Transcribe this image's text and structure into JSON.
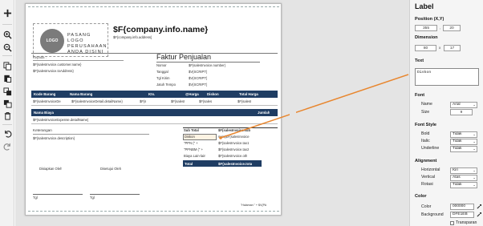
{
  "toolbar": {
    "buttons": [
      {
        "icon": "plus-icon",
        "label": "add"
      },
      {
        "icon": "zoom-in-icon",
        "label": "zoom in"
      },
      {
        "icon": "zoom-out-icon",
        "label": "zoom out"
      },
      {
        "icon": "copy-icon",
        "label": "copy"
      },
      {
        "icon": "paste-icon",
        "label": "paste"
      },
      {
        "icon": "bring-front-icon",
        "label": "bring to front"
      },
      {
        "icon": "send-back-icon",
        "label": "send to back"
      },
      {
        "icon": "trash-icon",
        "label": "delete"
      },
      {
        "icon": "undo-icon",
        "label": "undo"
      },
      {
        "icon": "redo-icon",
        "label": "redo"
      }
    ]
  },
  "report": {
    "logo_circle": "LOGO",
    "logo_lines": [
      "PASANG LOGO",
      "PERUSAHAAN",
      "ANDA DISINI"
    ],
    "company_name": "$F{company.info.name}",
    "company_address": "$F{company.info.address}",
    "kepada_label": "Kepada :",
    "customer_name": "$F{salesInvoice.customer.name}",
    "to_address": "$F{salesInvoice.toAddress}",
    "title": "Faktur Penjualan",
    "info_rows": [
      {
        "label": "Nomor",
        "value": "$F{salesInvoice.number}"
      },
      {
        "label": "Tanggal",
        "value": "$V{SCRIPT}"
      },
      {
        "label": "Tgl Kirim",
        "value": "$V{SCRIPT}"
      },
      {
        "label": "Jatuh Tempo",
        "value": "$V{SCRIPT}"
      }
    ],
    "detail_headers": {
      "kode": "Kode Barang",
      "nama": "Nama Barang",
      "kts": "Kts.",
      "harga": "@Harga",
      "diskon": "Diskon",
      "total": "Total Harga"
    },
    "detail_row": {
      "kode": "$F{salesInvoiceDe",
      "nama": "$F{salesInvoiceDetail.detailName}",
      "kts": "$F{s",
      "harga": "$F{salesI",
      "diskon": "$F{sales",
      "total": "$F{salesI"
    },
    "biaya_header": {
      "nama": "Nama Biaya",
      "jumlah": "Jumlah"
    },
    "biaya_row": "$F{salesInvoiceExpense.detailName}",
    "keterangan_label": "Keterangan",
    "keterangan_value": "$F{salesInvoice.description}",
    "summary": [
      {
        "label": "Sub Total",
        "value": "$F{salesInvoice.sub"
      },
      {
        "label": "Diskon",
        "value": "sum($F{salesInvoice"
      },
      {
        "label": "\"PPN (\" +",
        "value": "$F{salesInvoice.tax1"
      },
      {
        "label": "\"PPNBM (\" +",
        "value": "$F{salesInvoice.tax2"
      },
      {
        "label": "Biaya Lain-lain",
        "value": "$F{salesInvoice.oth"
      },
      {
        "label": "Total",
        "value": "$F{salesInvoice.tota"
      }
    ],
    "disiapkan": "Disiapkan Oleh",
    "disetujui": "Disetujui Oleh",
    "tgl1": "Tgl",
    "tgl2": "Tgl",
    "halaman": "\"Halaman \" + $V{PA"
  },
  "panel": {
    "title": "Label",
    "position_label": "Position (X,Y)",
    "pos_x": "355",
    "pos_y": "20",
    "dimension_label": "Dimension",
    "dim_w": "80",
    "dim_x_sep": "x",
    "dim_h": "17",
    "text_label": "Text",
    "text_value": "Diskon",
    "font_label": "Font",
    "font_name_label": "Name",
    "font_name": "Arial",
    "font_size_label": "Size",
    "font_size": "9",
    "font_style_label": "Font Style",
    "bold_label": "Bold",
    "bold_value": "Tidak",
    "italic_label": "Italic",
    "italic_value": "Tidak",
    "underline_label": "Underline",
    "underline_value": "Tidak",
    "alignment_label": "Alignment",
    "horizontal_label": "Horizontal",
    "horizontal_value": "Kiri",
    "vertical_label": "Vertical",
    "vertical_value": "Atas",
    "rotasi_label": "Rotasi",
    "rotasi_value": "Tidak",
    "color_label": "Color",
    "color_field_label": "Color",
    "color_value": "000000",
    "background_label": "Background",
    "background_value": "DFE1EB",
    "transparan_label": "Transparan"
  },
  "colors": {
    "band": "#1f3d63",
    "connector": "#e8862e",
    "selection_fill": "#fdf3e3"
  }
}
